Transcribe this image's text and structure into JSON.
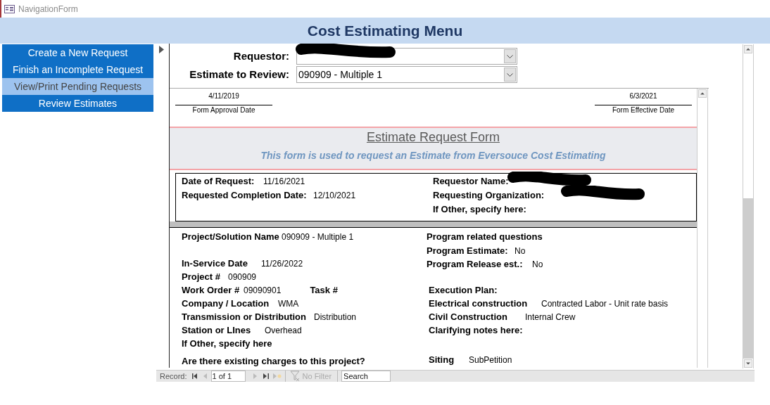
{
  "window": {
    "title": "NavigationForm"
  },
  "header": {
    "title": "Cost Estimating Menu"
  },
  "nav": [
    {
      "label": "Create a New Request",
      "selected": false
    },
    {
      "label": "Finish an Incomplete Request",
      "selected": false
    },
    {
      "label": "View/Print Pending Requests",
      "selected": true
    },
    {
      "label": "Review Estimates",
      "selected": false
    }
  ],
  "selectors": [
    {
      "label": "Requestor:",
      "redacted": true
    },
    {
      "label": "Estimate to Review:",
      "value": "090909 - Multiple 1"
    }
  ],
  "form": {
    "approval_date": {
      "value": "4/11/2019",
      "label": "Form Approval Date"
    },
    "effective_date": {
      "value": "6/3/2021",
      "label": "Form Effective Date"
    },
    "title": "Estimate Request Form",
    "subtitle": "This form is used to request an Estimate from Eversouce Cost Estimating",
    "request_left": [
      {
        "label": "Date of Request:",
        "value": "11/16/2021"
      },
      {
        "label": "Requested Completion Date:",
        "value": "12/10/2021"
      }
    ],
    "request_right": [
      {
        "label": "Requestor Name:",
        "redacted": true
      },
      {
        "label": "Requesting Organization:",
        "redacted": true
      },
      {
        "label": "If Other, specify here:"
      }
    ],
    "details_left": [
      {
        "label": "Project/Solution Name",
        "value": "090909 - Multiple 1"
      },
      {
        "label": "In-Service Date",
        "value": "11/26/2022"
      },
      {
        "label": "Project #",
        "value": "090909"
      },
      {
        "label": "Work Order #",
        "value": "09090901",
        "extra_label": "Task #"
      },
      {
        "label": "Company / Location",
        "value": "WMA"
      },
      {
        "label": "Transmission or Distribution",
        "value": "Distribution"
      },
      {
        "label": "Station or LInes",
        "value": "Overhead"
      },
      {
        "label": "If Other, specify here"
      },
      {
        "label": "Are there existing charges to this project?"
      }
    ],
    "details_right": [
      {
        "label": "Program related questions"
      },
      {
        "label": "Program Estimate:",
        "value": "No"
      },
      {
        "label": "Program Release est.:",
        "value": "No"
      },
      {
        "label": "Execution Plan:"
      },
      {
        "label": "Electrical construction",
        "value": "Contracted Labor - Unit rate basis"
      },
      {
        "label": "Civil Construction",
        "value": "Internal Crew"
      },
      {
        "label": "Clarifying notes here:"
      },
      {
        "label": "Siting",
        "value": "SubPetition"
      }
    ]
  },
  "record_bar": {
    "label": "Record:",
    "position": "1 of 1",
    "filter": "No Filter",
    "search_placeholder": "Search"
  }
}
